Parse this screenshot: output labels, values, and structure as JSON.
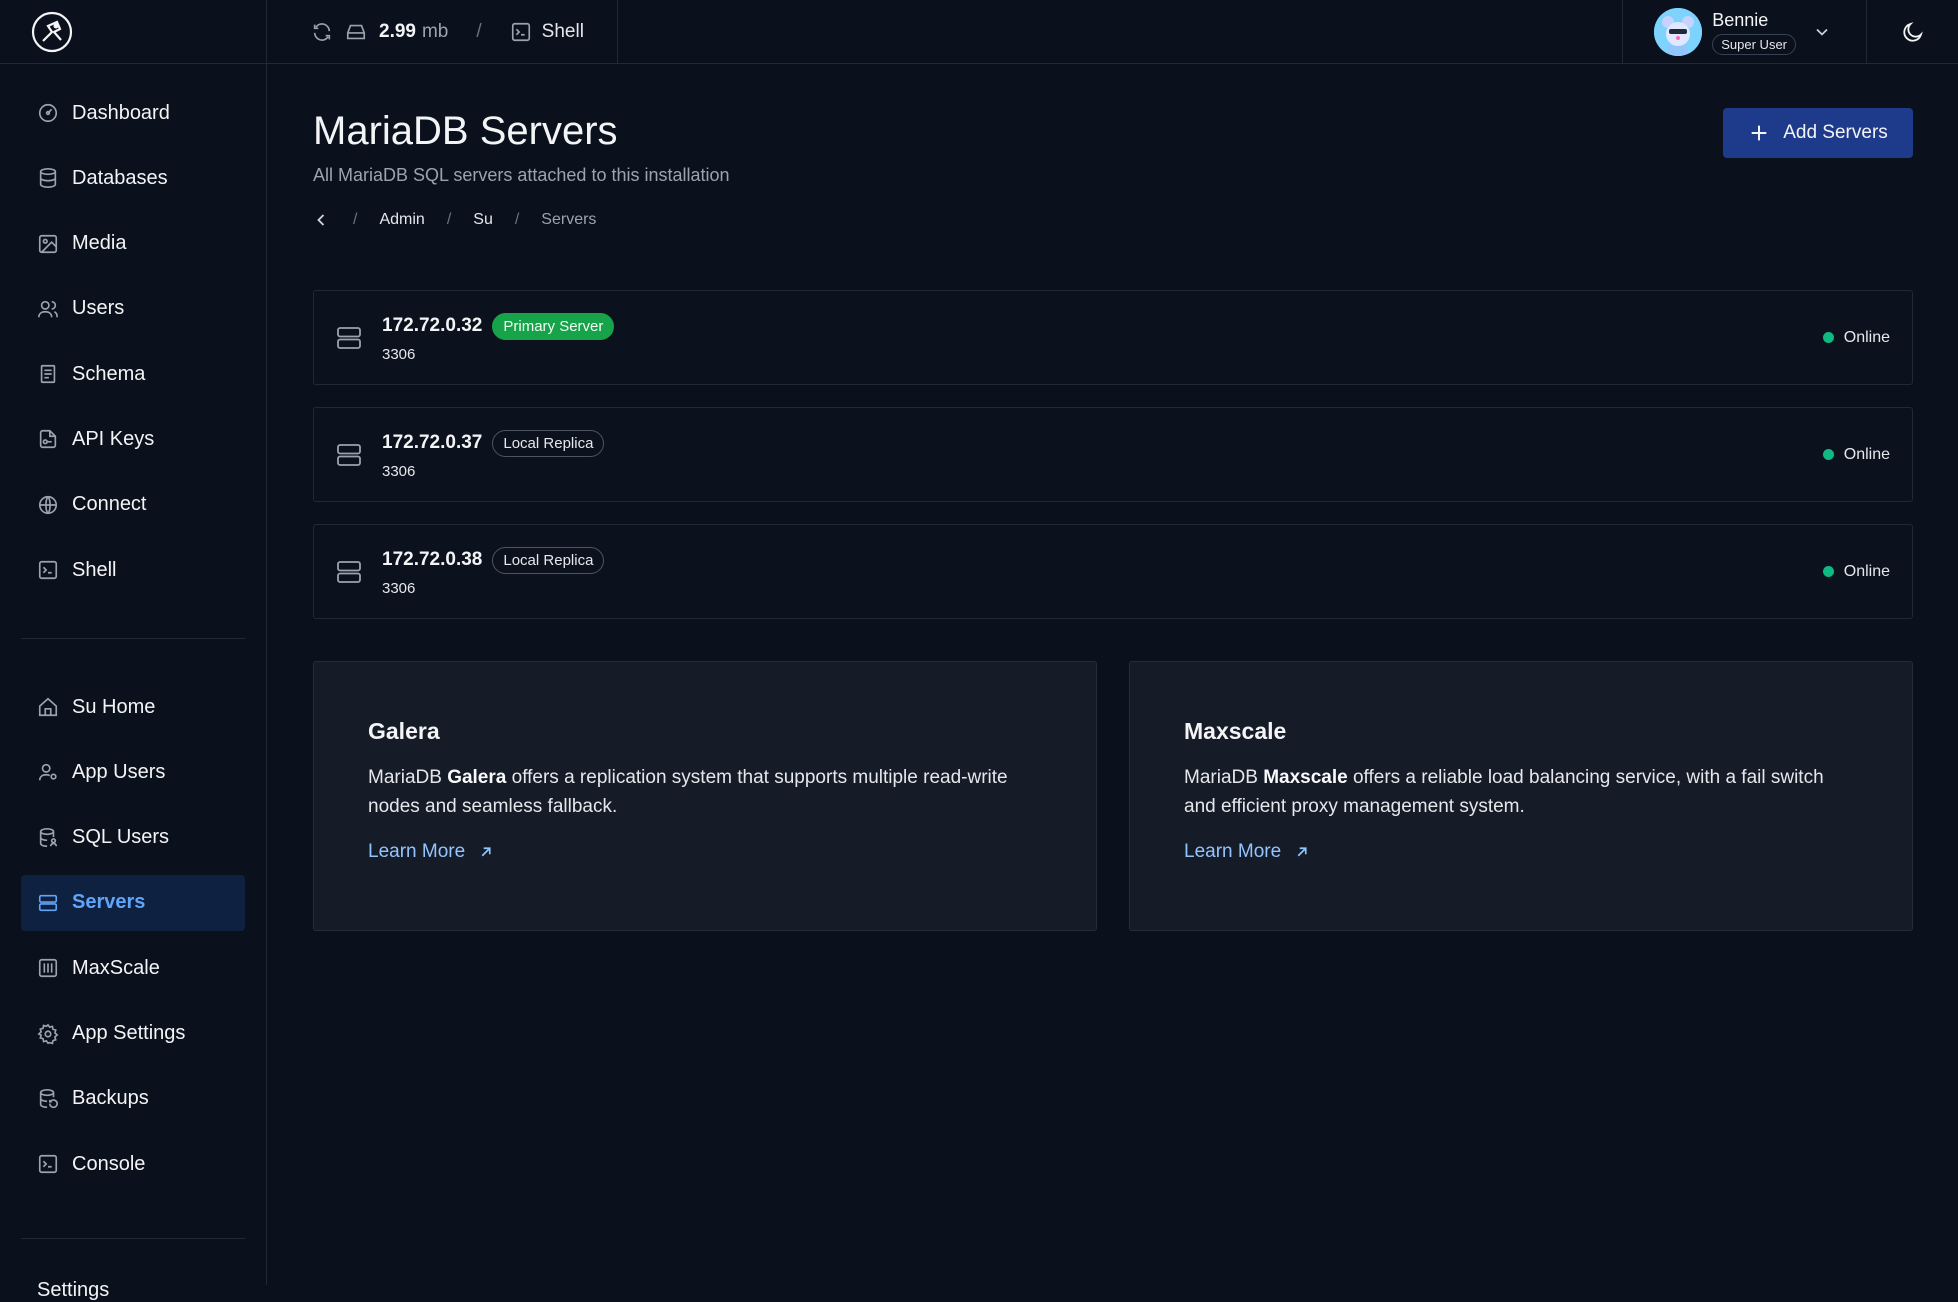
{
  "topbar": {
    "storage_value": "2.99",
    "storage_unit": "mb",
    "separator": "/",
    "shell_label": "Shell",
    "user_name": "Bennie",
    "user_role": "Super User"
  },
  "sidebar": {
    "primary": [
      {
        "label": "Dashboard",
        "icon": "dashboard-icon"
      },
      {
        "label": "Databases",
        "icon": "database-icon"
      },
      {
        "label": "Media",
        "icon": "media-icon"
      },
      {
        "label": "Users",
        "icon": "users-icon"
      },
      {
        "label": "Schema",
        "icon": "schema-icon"
      },
      {
        "label": "API Keys",
        "icon": "api-key-icon"
      },
      {
        "label": "Connect",
        "icon": "globe-icon"
      },
      {
        "label": "Shell",
        "icon": "terminal-icon"
      }
    ],
    "su": [
      {
        "label": "Su Home",
        "icon": "home-icon"
      },
      {
        "label": "App Users",
        "icon": "user-settings-icon"
      },
      {
        "label": "SQL Users",
        "icon": "database-user-icon"
      },
      {
        "label": "Servers",
        "icon": "servers-icon",
        "active": true
      },
      {
        "label": "MaxScale",
        "icon": "maxscale-icon"
      },
      {
        "label": "App Settings",
        "icon": "gear-icon"
      },
      {
        "label": "Backups",
        "icon": "backup-icon"
      },
      {
        "label": "Console",
        "icon": "console-icon"
      }
    ],
    "settings_label": "Settings"
  },
  "page": {
    "title": "MariaDB Servers",
    "subtitle": "All MariaDB SQL servers attached to this installation",
    "add_button": "Add Servers"
  },
  "breadcrumb": {
    "sep": "/",
    "items": [
      "Admin",
      "Su",
      "Servers"
    ]
  },
  "servers": [
    {
      "ip": "172.72.0.32",
      "badge": "Primary Server",
      "port": "3306",
      "status": "Online"
    },
    {
      "ip": "172.72.0.37",
      "badge": "Local Replica",
      "port": "3306",
      "status": "Online"
    },
    {
      "ip": "172.72.0.38",
      "badge": "Local Replica",
      "port": "3306",
      "status": "Online"
    }
  ],
  "cards": [
    {
      "title": "Galera",
      "text_prefix": "MariaDB ",
      "text_bold": "Galera",
      "text_suffix": " offers a replication system that supports multiple read-write nodes and seamless fallback.",
      "link": "Learn More"
    },
    {
      "title": "Maxscale",
      "text_prefix": "MariaDB ",
      "text_bold": "Maxscale",
      "text_suffix": " offers a reliable load balancing service, with a fail switch and efficient proxy management system.",
      "link": "Learn More"
    }
  ],
  "colors": {
    "background": "#0b111c",
    "accent": "#1e3a8a",
    "active_nav": "#60a5fa",
    "primary_badge": "#16a34a",
    "online": "#10b981",
    "link": "#93c5fd"
  }
}
